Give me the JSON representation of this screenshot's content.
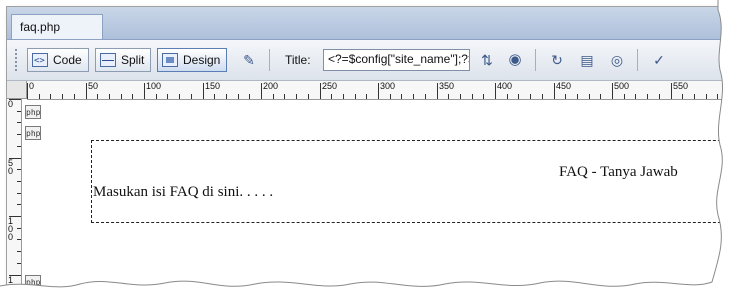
{
  "tab": {
    "label": "faq.php"
  },
  "toolbar": {
    "code_label": "Code",
    "split_label": "Split",
    "design_label": "Design",
    "title_label": "Title:",
    "title_value": "<?=$config[\"site_name\"];?> -"
  },
  "ruler": {
    "h_labels": [
      "0",
      "50",
      "100",
      "150",
      "200",
      "250",
      "300",
      "350",
      "400",
      "450",
      "500",
      "550"
    ],
    "v_labels": [
      "0",
      "50",
      "100",
      "150"
    ]
  },
  "content": {
    "php_tag": "php",
    "faq_title": "FAQ - Tanya Jawab",
    "faq_body": "Masukan isi FAQ di sini. . . . ."
  }
}
